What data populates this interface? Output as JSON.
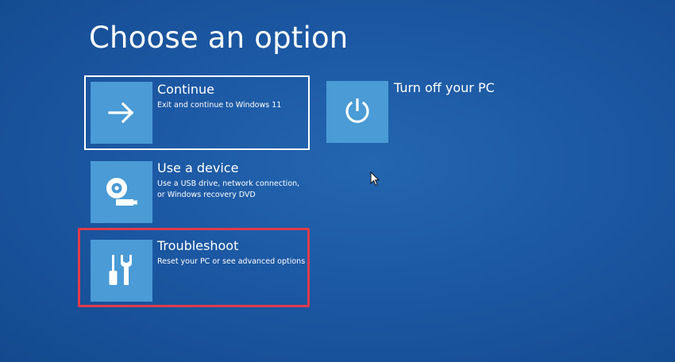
{
  "page": {
    "title": "Choose an option"
  },
  "options": [
    {
      "id": "continue",
      "title": "Continue",
      "description": [
        "Exit and continue to Windows 11"
      ],
      "icon": "arrow-right-icon",
      "focused": true
    },
    {
      "id": "use-device",
      "title": "Use a device",
      "description": [
        "Use a USB drive, network connection,",
        "or Windows recovery DVD"
      ],
      "icon": "usb-disc-icon"
    },
    {
      "id": "troubleshoot",
      "title": "Troubleshoot",
      "description": [
        "Reset your PC or see advanced options"
      ],
      "icon": "tools-icon",
      "highlighted": true
    },
    {
      "id": "turn-off",
      "title": "Turn off your PC",
      "description": [],
      "icon": "power-icon"
    }
  ],
  "colors": {
    "background": "#1c58a3",
    "tile": "#4a9bd6",
    "focus_border": "#ffffff",
    "highlight_annotation": "#e23b4a"
  }
}
